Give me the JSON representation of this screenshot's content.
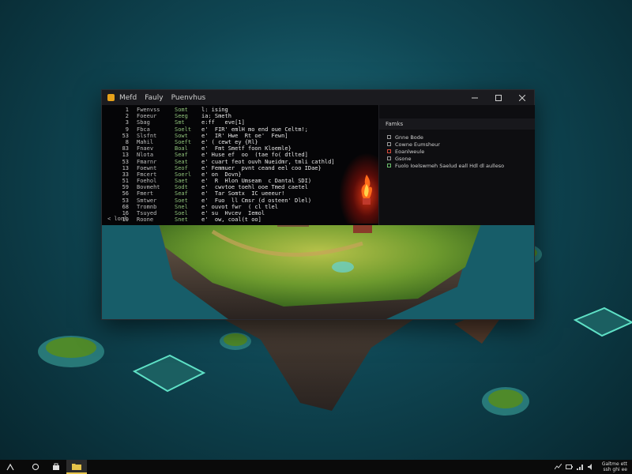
{
  "window": {
    "menu": [
      "Mefd",
      "Fauly",
      "Puenvhus"
    ],
    "controls": {
      "minimize": "minimize",
      "maximize": "maximize",
      "close": "close"
    }
  },
  "terminal": {
    "lines": [
      [
        "1",
        "Fwenvss",
        "Somt",
        "l: ising"
      ],
      [
        "2",
        "Foeeur",
        "Seeg",
        "ia: Smeth"
      ],
      [
        "3",
        "Sbag",
        "Smt",
        "e:ff   eve[1]"
      ],
      [
        "9",
        "Fbca",
        "Soelt",
        "e'  FIR' emlH mo end oue Celtm!;"
      ],
      [
        "53",
        "Slsfnt",
        "Sowt",
        "e'  IR' Hwe  Rt oe'  Fewn]"
      ],
      [
        "8",
        "Mahil",
        "Soeft",
        "e' ( cewt ey {Rl}"
      ],
      [
        "83",
        "Fnaev",
        "Boal",
        "e'  Fmt Smetf foon Kloemle}"
      ],
      [
        "13",
        "Nlota",
        "Seaf",
        "e' Huse ef  oo  (tae fo( dtlted]"
      ],
      [
        "53",
        "Fmarnr",
        "Seat",
        "e' cuart feot ouvh Nueidmr, tmli cathld]"
      ],
      [
        "13",
        "Foewnt",
        "Seof",
        "e' Femmuer  pvnt ceand eel coo IDae}"
      ],
      [
        "33",
        "Fmcert",
        "Soerl",
        "e' on  Dovn}"
      ],
      [
        "51",
        "Foehol",
        "Saet",
        "e'  R  Hlon Umseam  c Dantal SDI)"
      ],
      [
        "59",
        "Bovmeht",
        "Sodt",
        "e'  cwvtoe toehl ooe Tmed caetel"
      ],
      [
        "56",
        "Fmert",
        "Seaf",
        "e'  Tar Somtx  IC ueeeur!"
      ],
      [
        "53",
        "Smtwer",
        "Soet",
        "e'  Fuo  ll Cmsr (d osteen' Dlel)"
      ],
      [
        "68",
        "Tromnb",
        "Snel",
        "e' ouvot fwr  ( cl tlel"
      ],
      [
        "16",
        "Tsuyed",
        "Soel",
        "e' su  Hvcev  Iemol"
      ],
      [
        "19",
        "Roone",
        "Snet",
        "e'  ow, coal(t oo]"
      ]
    ],
    "prompt": "< lonl"
  },
  "side_panel": {
    "header": "Famks",
    "items": [
      {
        "label": "Gnne Bode",
        "color": "#9a9a9a"
      },
      {
        "label": "Cowne Eumsheur",
        "color": "#9a9a9a"
      },
      {
        "label": "Eoanlweule",
        "color": "#d84a3a"
      },
      {
        "label": "Gsone",
        "color": "#9a9a9a"
      },
      {
        "label": "Fuolo Ioelswmeh Saelud eall Hdl dl aulleso",
        "color": "#6cbf6c"
      }
    ]
  },
  "taskbar": {
    "clock_line1": "Galtme ett",
    "clock_line2": "ssh ghi ee"
  },
  "colors": {
    "accent": "#e6c34a",
    "terminal_bg": "#050507",
    "water": "#1f6f7e"
  }
}
